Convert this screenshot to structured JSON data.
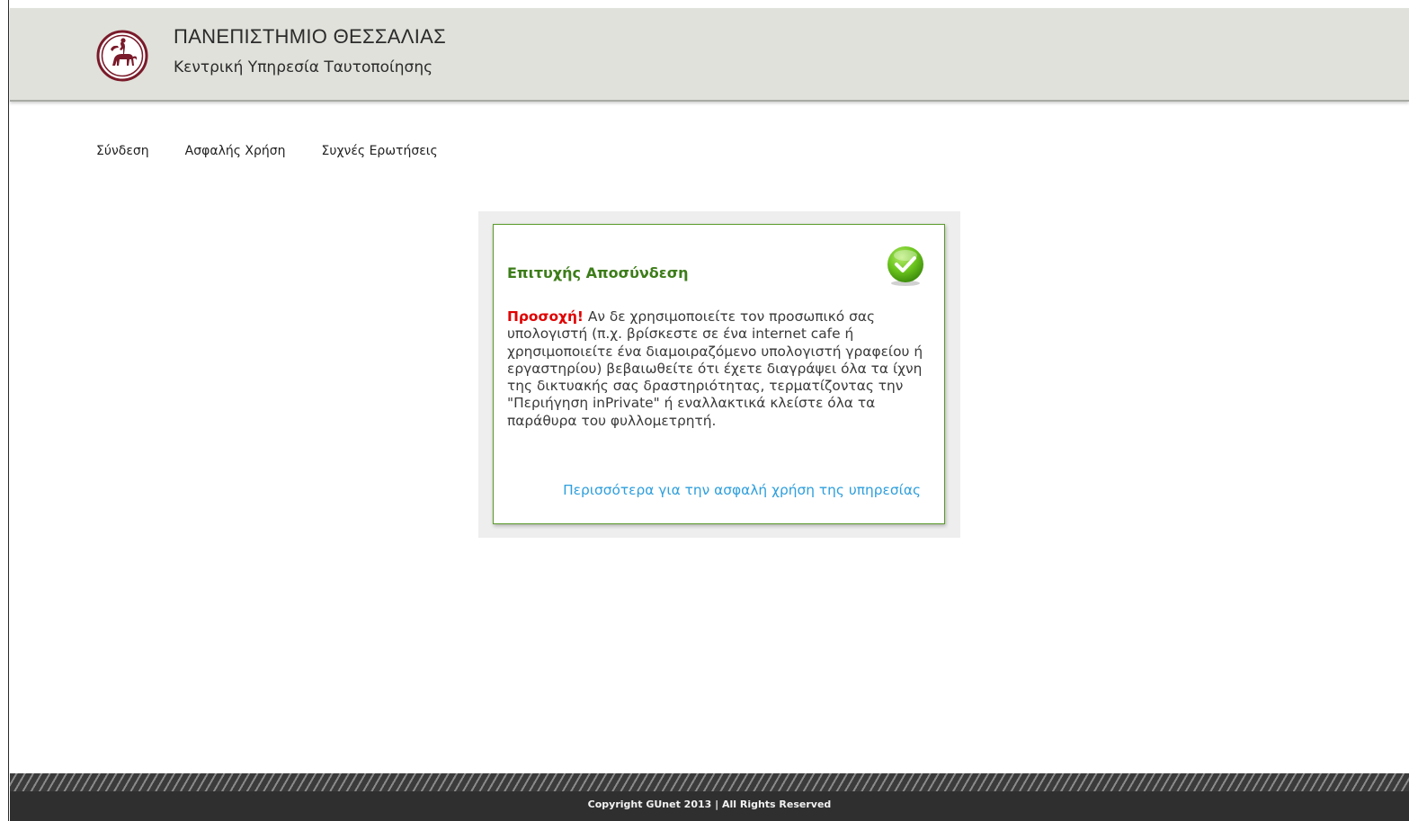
{
  "header": {
    "university_name": "ΠΑΝΕΠΙΣΤΗΜΙΟ ΘΕΣΣΑΛΙΑΣ",
    "service_name": "Κεντρική Υπηρεσία Ταυτοποίησης",
    "logo_icon": "centaur-logo-icon",
    "logo_color": "#7a1a2a",
    "background_color": "#dfe1da"
  },
  "nav": {
    "items": [
      {
        "label": "Σύνδεση"
      },
      {
        "label": "Ασφαλής Χρήση"
      },
      {
        "label": "Συχνές Ερωτήσεις"
      }
    ]
  },
  "panel": {
    "title": "Επιτυχής Αποσύνδεση",
    "status_icon": "success-check-icon",
    "warning_label": "Προσοχή!",
    "message": " Αν δε χρησιμοποιείτε τον προσωπικό σας υπολογιστή (π.χ. βρίσκεστε σε ένα internet cafe ή χρησιμοποιείτε ένα διαμοιραζόμενο υπολογιστή γραφείου ή εργαστηρίου) βεβαιωθείτε ότι έχετε διαγράψει όλα τα ίχνη της δικτυακής σας δραστηριότητας, τερματίζοντας την \"Περιήγηση inPrivate\" ή εναλλακτικά κλείστε όλα τα παράθυρα του φυλλομετρητή.",
    "more_link": "Περισσότερα για την ασφαλή χρήση της υπηρεσίας",
    "title_color": "#3c7d18",
    "warning_color": "#e00000",
    "link_color": "#2e9fdd"
  },
  "footer": {
    "copyright": "Copyright GUnet 2013 | All Rights Reserved"
  }
}
